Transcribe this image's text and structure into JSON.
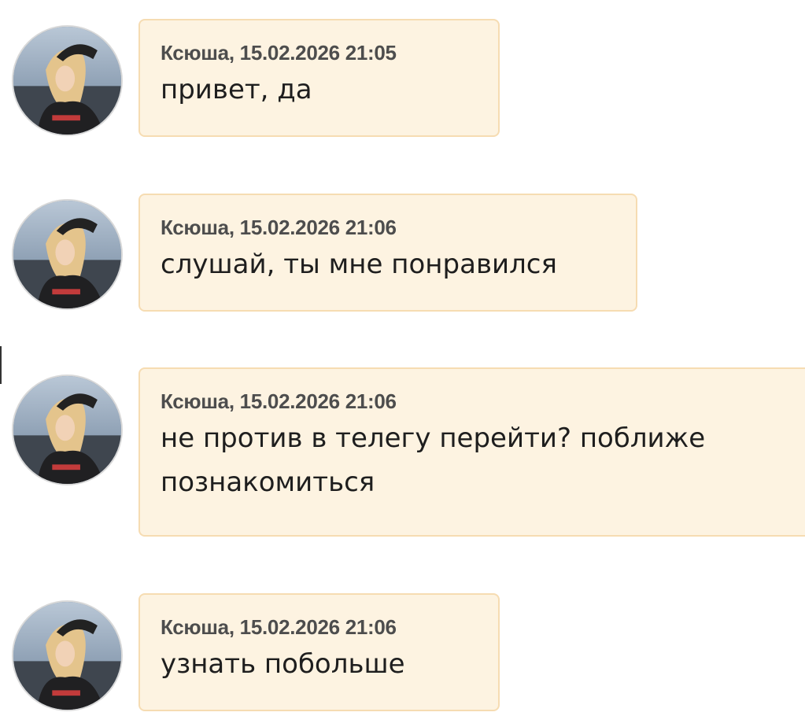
{
  "conversation": {
    "messages": [
      {
        "author": "Ксюша",
        "datetime": "15.02.2026 21:05",
        "header": "Ксюша, 15.02.2026 21:05",
        "text": "привет, да",
        "avatar_icon": "user-avatar-photo"
      },
      {
        "author": "Ксюша",
        "datetime": "15.02.2026 21:06",
        "header": "Ксюша, 15.02.2026 21:06",
        "text": "слушай, ты мне понравился",
        "avatar_icon": "user-avatar-photo"
      },
      {
        "author": "Ксюша",
        "datetime": "15.02.2026 21:06",
        "header": "Ксюша, 15.02.2026 21:06",
        "text": "не против в телегу перейти? поближе познакомиться",
        "avatar_icon": "user-avatar-photo"
      },
      {
        "author": "Ксюша",
        "datetime": "15.02.2026 21:06",
        "header": "Ксюша, 15.02.2026 21:06",
        "text": "узнать побольше",
        "avatar_icon": "user-avatar-photo"
      }
    ]
  },
  "colors": {
    "bubble_background": "#fdf3e1",
    "bubble_border": "#f6dcb2",
    "meta_text": "#4d4d4d",
    "message_text": "#1e1e1e",
    "page_background": "#ffffff"
  }
}
